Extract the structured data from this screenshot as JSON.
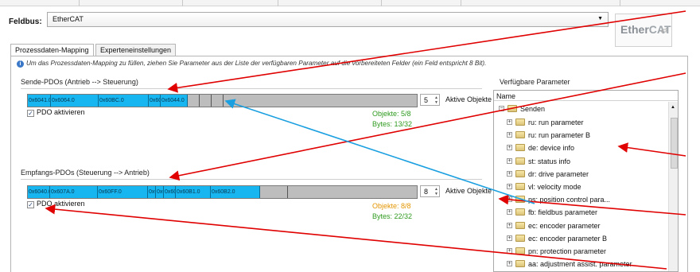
{
  "header": {
    "fieldbus_label": "Feldbus:",
    "fieldbus_value": "EtherCAT",
    "logo_text_a": "Ether",
    "logo_text_b": "CAT"
  },
  "tabs": [
    {
      "label": "Prozessdaten-Mapping",
      "active": true
    },
    {
      "label": "Experteneinstellungen",
      "active": false
    }
  ],
  "info_text": "Um das Prozessdaten-Mapping zu füllen, ziehen Sie Parameter aus der Liste der verfügbaren Parameter auf die vorbereiteten Felder (ein Feld entspricht 8 Bit).",
  "send": {
    "title": "Sende-PDOs (Antrieb --> Steuerung)",
    "segments": [
      "0x6041.0",
      "0x6064.0",
      "0x60BC.0",
      "0x6091.0",
      "0x6044.0"
    ],
    "count": "5",
    "count_label": "Aktive Objekte",
    "pdo_label": "PDO aktivieren",
    "objects": "Objekte: 5/8",
    "bytes": "Bytes: 13/32"
  },
  "receive": {
    "title": "Empfangs-PDOs (Steuerung --> Antrieb)",
    "segments": [
      "0x6040.0",
      "0x607A.0",
      "0x60FF.0",
      "0x6071.0",
      "0x6072.0",
      "0x6042.0",
      "0x60B1.0",
      "0x60B2.0"
    ],
    "count": "8",
    "count_label": "Aktive Objekte",
    "pdo_label": "PDO aktivieren",
    "objects": "Objekte: 8/8",
    "bytes": "Bytes: 22/32"
  },
  "available": {
    "title": "Verfügbare Parameter",
    "column": "Name",
    "root": "Senden",
    "items": [
      "ru: run parameter",
      "ru: run parameter B",
      "de: device info",
      "st: status info",
      "dr: drive parameter",
      "vl: velocity mode",
      "ps: position control para...",
      "fb: fieldbus parameter",
      "ec: encoder parameter",
      "ec: encoder parameter B",
      "pn: protection parameter",
      "aa: adjustment assist. parameter"
    ]
  },
  "colors": {
    "segment_fill": "#18b6f0",
    "ok_green": "#2e9a1e",
    "full_orange": "#e39500",
    "annotation_red": "#e00000",
    "annotation_blue": "#1a9fe0"
  }
}
